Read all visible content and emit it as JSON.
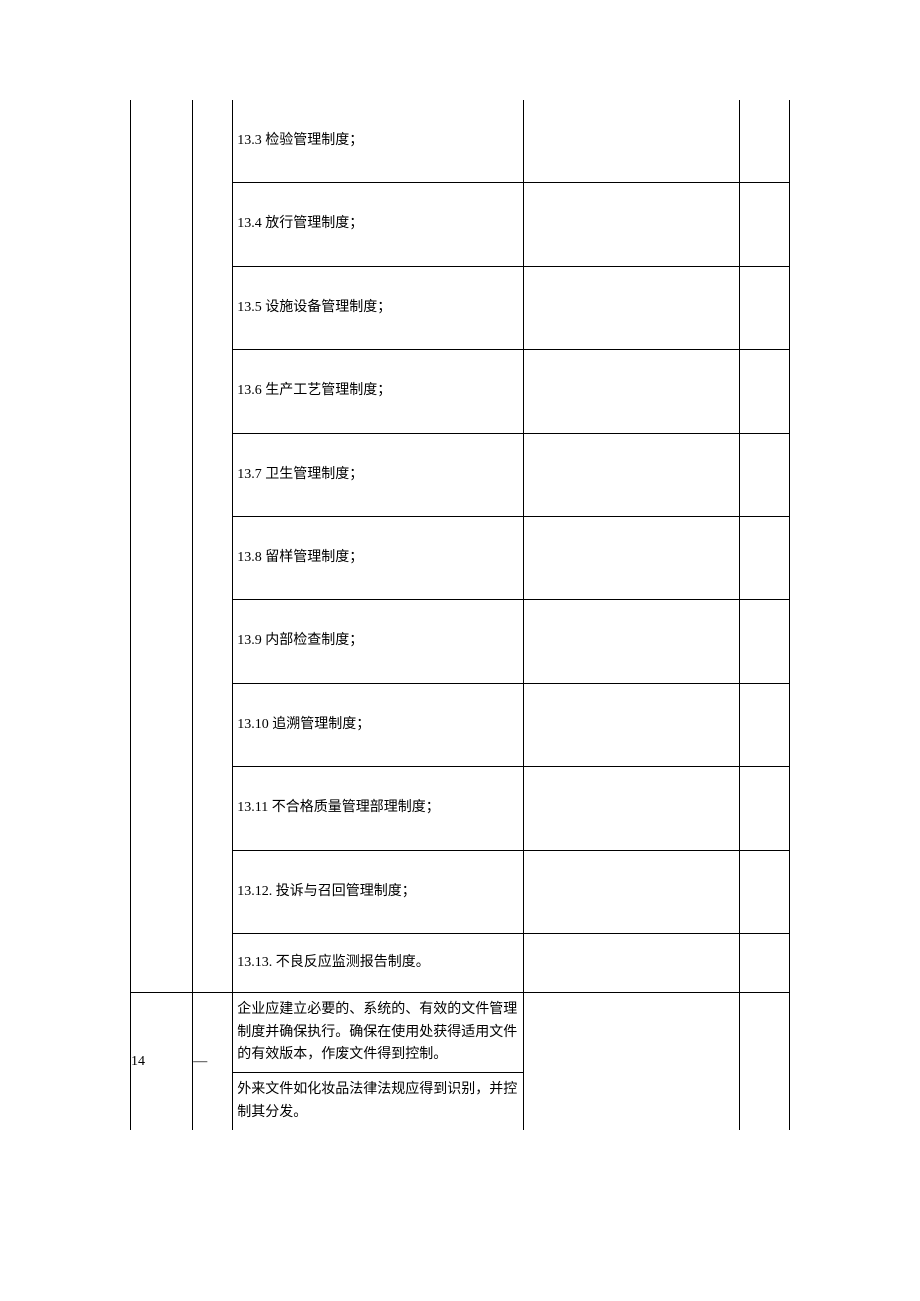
{
  "rows_group1": [
    {
      "text": "13.3 检验管理制度；"
    },
    {
      "text": "13.4 放行管理制度；"
    },
    {
      "text": "13.5 设施设备管理制度；"
    },
    {
      "text": "13.6 生产工艺管理制度；"
    },
    {
      "text": "13.7 卫生管理制度；"
    },
    {
      "text": "13.8 留样管理制度；"
    },
    {
      "text": "13.9 内部检查制度；"
    },
    {
      "text": "13.10 追溯管理制度；"
    },
    {
      "text": "13.11 不合格质量管理部理制度；"
    },
    {
      "text": "13.12. 投诉与召回管理制度；"
    },
    {
      "text": "13.13. 不良反应监测报告制度。"
    }
  ],
  "row14": {
    "num": "14",
    "mark": "—",
    "para1": "企业应建立必要的、系统的、有效的文件管理制度并确保执行。确保在使用处获得适用文件的有效版本，作废文件得到控制。",
    "para2": "外来文件如化妆品法律法规应得到识别，并控制其分发。"
  }
}
